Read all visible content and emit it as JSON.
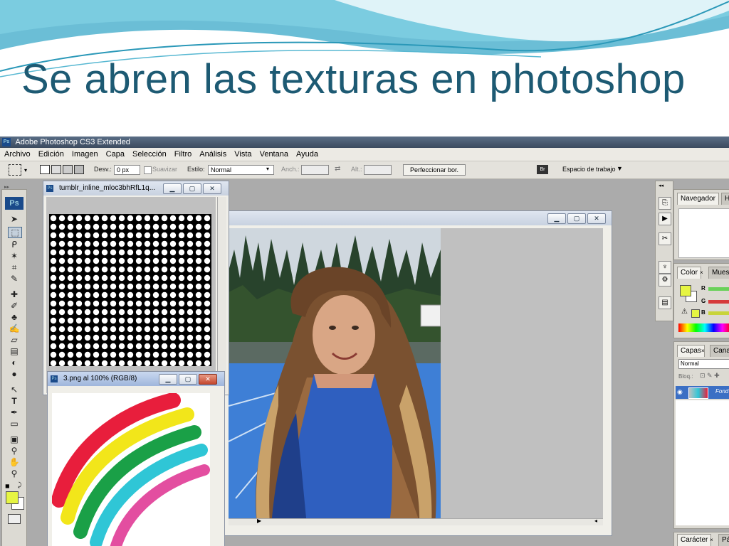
{
  "slide": {
    "title": "Se abren las texturas en photoshop"
  },
  "app": {
    "window_title": "Adobe Photoshop CS3 Extended",
    "logo": "Ps"
  },
  "menu": [
    "Archivo",
    "Edición",
    "Imagen",
    "Capa",
    "Selección",
    "Filtro",
    "Análisis",
    "Vista",
    "Ventana",
    "Ayuda"
  ],
  "options": {
    "feather_label": "Desv.:",
    "feather_value": "0 px",
    "antialias_label": "Suavizar",
    "style_label": "Estilo:",
    "style_value": "Normal",
    "width_label": "Anch.:",
    "height_label": "Alt.:",
    "refine_button": "Perfeccionar bor.",
    "workspace_label": "Espacio de trabajo"
  },
  "documents": {
    "texture": {
      "title": "tumblr_inline_mloc3bhRfL1q..."
    },
    "rainbow": {
      "title": "3.png al 100% (RGB/8)"
    },
    "photo": {
      "title": ""
    }
  },
  "panels": {
    "navigator_tab": "Navegador",
    "histogram_tab": "H",
    "color_tab": "Color",
    "swatches_tab": "Mues",
    "layers_tab": "Capas",
    "channels_tab": "Cana",
    "blend_mode": "Normal",
    "lock_label": "Bloq.:",
    "layer_name": "Fond",
    "character_tab": "Carácter",
    "paragraph_tab": "Pá",
    "channel_r": "R",
    "channel_g": "G",
    "channel_b": "B"
  },
  "colors": {
    "foreground": "#e6f542",
    "background": "#ffffff",
    "accent_title": "#1d5a73"
  },
  "tools": [
    "move-icon",
    "marquee-icon",
    "lasso-icon",
    "magic-wand-icon",
    "crop-icon",
    "slice-icon",
    "healing-icon",
    "brush-icon",
    "clone-stamp-icon",
    "history-brush-icon",
    "eraser-icon",
    "gradient-icon",
    "blur-icon",
    "dodge-icon",
    "path-selection-icon",
    "type-icon",
    "pen-icon",
    "shape-icon",
    "notes-icon",
    "eyedropper-icon",
    "hand-icon",
    "zoom-icon"
  ]
}
